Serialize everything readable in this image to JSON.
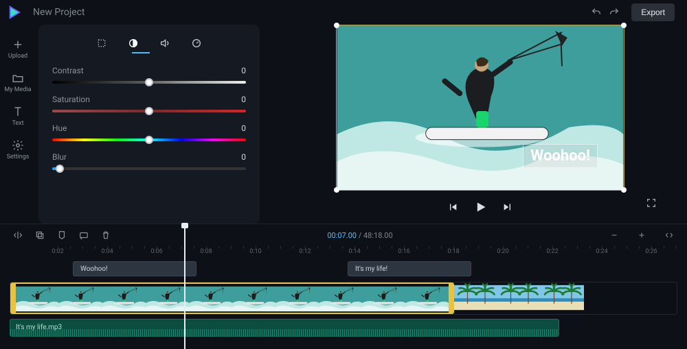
{
  "project_title": "New Project",
  "export_label": "Export",
  "rail": [
    {
      "id": "upload",
      "label": "Upload"
    },
    {
      "id": "mymedia",
      "label": "My Media"
    },
    {
      "id": "text",
      "label": "Text"
    },
    {
      "id": "settings",
      "label": "Settings"
    }
  ],
  "adjust": {
    "contrast": {
      "label": "Contrast",
      "value": "0",
      "thumb_pct": 50
    },
    "saturation": {
      "label": "Saturation",
      "value": "0",
      "thumb_pct": 50
    },
    "hue": {
      "label": "Hue",
      "value": "0",
      "thumb_pct": 50
    },
    "blur": {
      "label": "Blur",
      "value": "0",
      "thumb_pct": 4
    }
  },
  "overlay_text": "Woohoo!",
  "time": {
    "current": "00:07.00",
    "total": "48:18.00"
  },
  "ruler": [
    "0:02",
    "0:04",
    "0:06",
    "0:08",
    "0:10",
    "0:12",
    "0:14",
    "0:16",
    "0:18",
    "0:20",
    "0:22",
    "0:24",
    "0:26"
  ],
  "text_chips": [
    "Woohoo!",
    "It's my life!"
  ],
  "audio_clip_name": "It's my life.mp3",
  "colors": {
    "accent": "#4fbcff",
    "selection": "#e8c341"
  }
}
